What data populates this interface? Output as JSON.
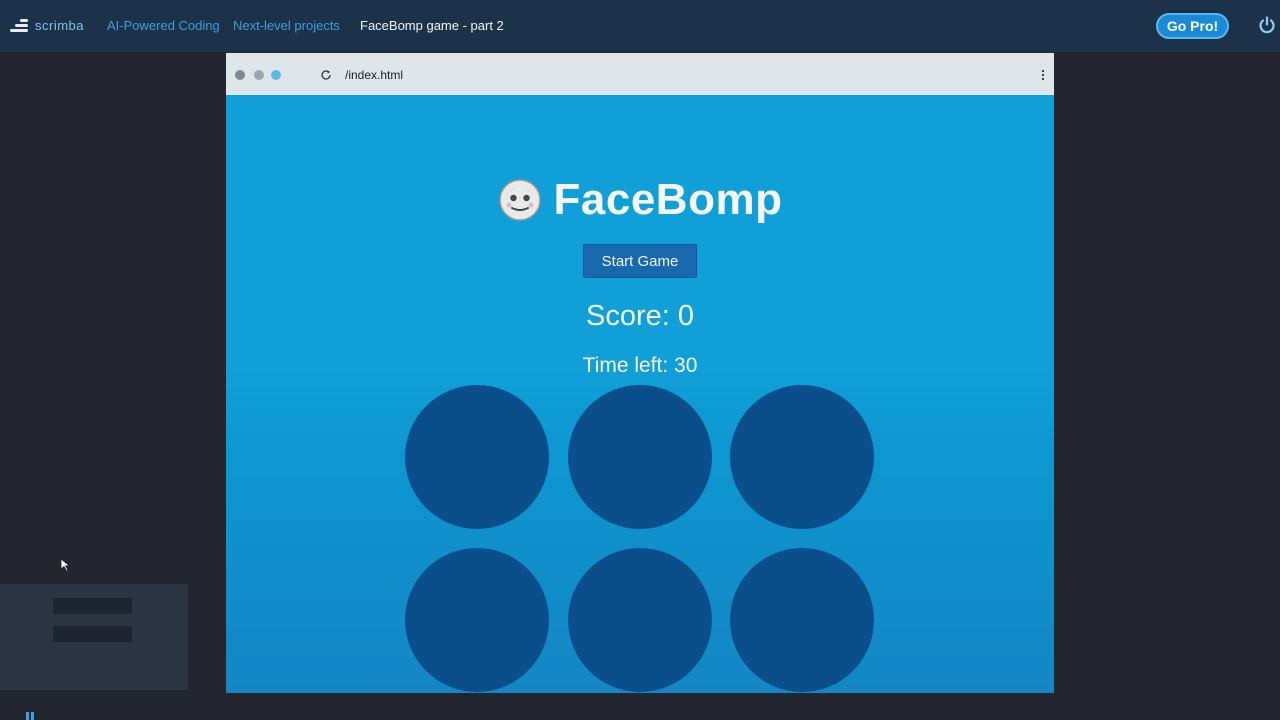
{
  "topbar": {
    "logo_text": "scrimba",
    "breadcrumbs": [
      "AI-Powered Coding",
      "Next-level projects",
      "FaceBomp game - part 2"
    ],
    "cta_label": "Go Pro!"
  },
  "browser": {
    "url": "/index.html"
  },
  "game": {
    "title": "FaceBomp",
    "start_button": "Start Game",
    "score_label": "Score: 0",
    "time_label": "Time left: 30",
    "hole_count": 6
  },
  "colors": {
    "topbar_bg": "#1c3248",
    "game_bg": "#109fd7",
    "hole": "#0a4e8b",
    "button": "#1868ae",
    "cta": "#1a8ad6"
  },
  "icons": {
    "logo": "scrimba-logo-icon",
    "power": "power-icon",
    "reload": "reload-icon",
    "menu": "kebab-menu-icon",
    "face": "face-emoji-icon"
  }
}
